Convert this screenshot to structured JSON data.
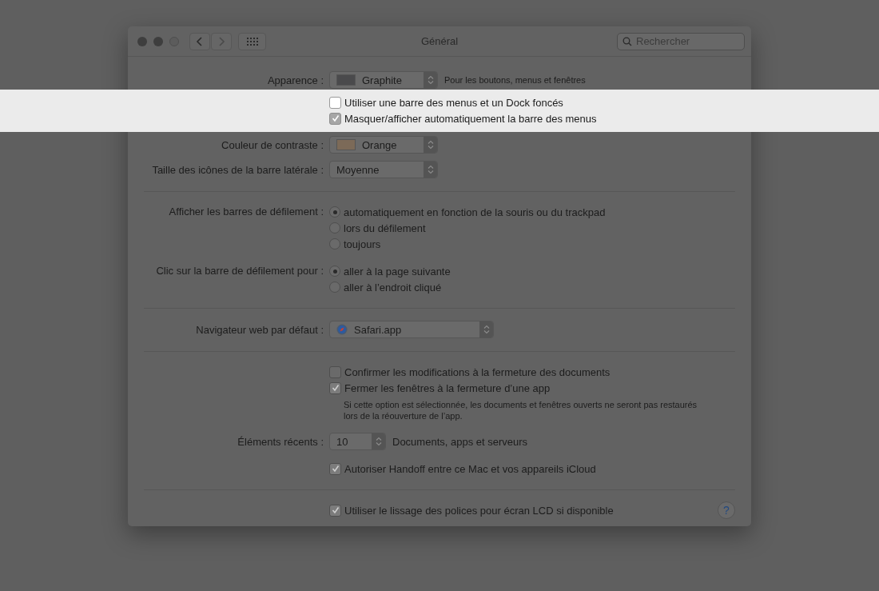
{
  "window": {
    "title": "Général"
  },
  "toolbar": {
    "search": {
      "placeholder": "Rechercher"
    }
  },
  "sections": [
    {
      "rows": [
        {
          "kind": "popup",
          "label": "Apparence :",
          "value": "Graphite",
          "color": "#4a4a4c",
          "note": "Pour les boutons, menus et fenêtres"
        },
        {
          "kind": "checkbox",
          "text": "Utiliser une barre des menus et un Dock foncés",
          "checked": false,
          "highlighted": true
        },
        {
          "kind": "checkbox",
          "text": "Masquer/afficher automatiquement la barre des menus",
          "checked": true,
          "highlighted": true
        },
        {
          "kind": "popup",
          "label": "Couleur de contraste :",
          "value": "Orange",
          "color": "#7c6a58"
        },
        {
          "kind": "popup",
          "label": "Taille des icônes de la barre latérale :",
          "value": "Moyenne"
        }
      ]
    },
    {
      "rows": [
        {
          "kind": "radio-group",
          "label": "Afficher les barres de défilement :",
          "options": [
            {
              "text": "automatiquement en fonction de la souris ou du trackpad",
              "selected": true
            },
            {
              "text": "lors du défilement",
              "selected": false
            },
            {
              "text": "toujours",
              "selected": false
            }
          ]
        },
        {
          "kind": "radio-group",
          "label": "Clic sur la barre de défilement pour :",
          "options": [
            {
              "text": "aller à la page suivante",
              "selected": true
            },
            {
              "text": "aller à l’endroit cliqué",
              "selected": false
            }
          ]
        }
      ]
    },
    {
      "rows": [
        {
          "kind": "app-popup",
          "label": "Navigateur web par défaut :",
          "value": "Safari.app"
        }
      ]
    },
    {
      "rows": [
        {
          "kind": "checkbox",
          "text": "Confirmer les modifications à la fermeture des documents",
          "checked": false,
          "highlighted": false
        },
        {
          "kind": "checkbox",
          "text": "Fermer les fenêtres à la fermeture d’une app",
          "checked": true,
          "highlighted": false
        },
        {
          "kind": "note",
          "text": "Si cette option est sélectionnée, les documents et fenêtres ouverts ne seront pas restaurés lors de la réouverture de l’app."
        },
        {
          "kind": "stepper",
          "label": "Éléments récents :",
          "value": "10",
          "note": "Documents, apps et serveurs"
        },
        {
          "kind": "checkbox",
          "text": "Autoriser Handoff entre ce Mac et vos appareils iCloud",
          "checked": true,
          "highlighted": false
        }
      ]
    },
    {
      "help_button": "?",
      "rows": [
        {
          "kind": "checkbox",
          "text": "Utiliser le lissage des polices pour écran LCD si disponible",
          "checked": true,
          "highlighted": false
        }
      ]
    }
  ]
}
